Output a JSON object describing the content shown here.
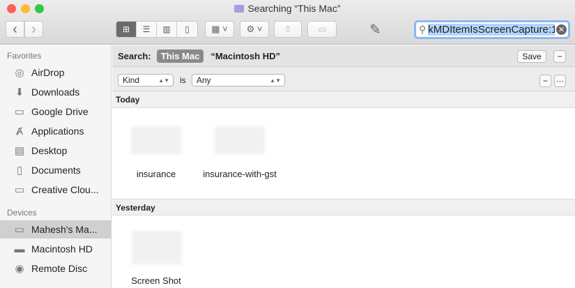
{
  "window": {
    "title": "Searching “This Mac”"
  },
  "toolbar": {
    "back": "‹",
    "forward": "›",
    "search_value": "kMDItemIsScreenCapture:1"
  },
  "sidebar": {
    "favorites_header": "Favorites",
    "favorites": [
      {
        "label": "AirDrop",
        "icon": "airdrop-icon"
      },
      {
        "label": "Downloads",
        "icon": "downloads-icon"
      },
      {
        "label": "Google Drive",
        "icon": "folder-icon"
      },
      {
        "label": "Applications",
        "icon": "applications-icon"
      },
      {
        "label": "Desktop",
        "icon": "desktop-icon"
      },
      {
        "label": "Documents",
        "icon": "documents-icon"
      },
      {
        "label": "Creative Clou...",
        "icon": "folder-icon"
      }
    ],
    "devices_header": "Devices",
    "devices": [
      {
        "label": "Mahesh's Ma...",
        "icon": "laptop-icon"
      },
      {
        "label": "Macintosh HD",
        "icon": "disk-icon"
      },
      {
        "label": "Remote Disc",
        "icon": "disc-icon"
      }
    ]
  },
  "searchbar": {
    "label": "Search:",
    "scope_active": "This Mac",
    "scope_other": "“Macintosh HD”",
    "save": "Save",
    "minus": "−"
  },
  "filter": {
    "attribute": "Kind",
    "op": "is",
    "value": "Any",
    "minus": "−",
    "more": "···"
  },
  "groups": [
    {
      "title": "Today",
      "items": [
        "insurance",
        "insurance-with-gst"
      ]
    },
    {
      "title": "Yesterday",
      "items": [
        "Screen Shot"
      ]
    }
  ]
}
